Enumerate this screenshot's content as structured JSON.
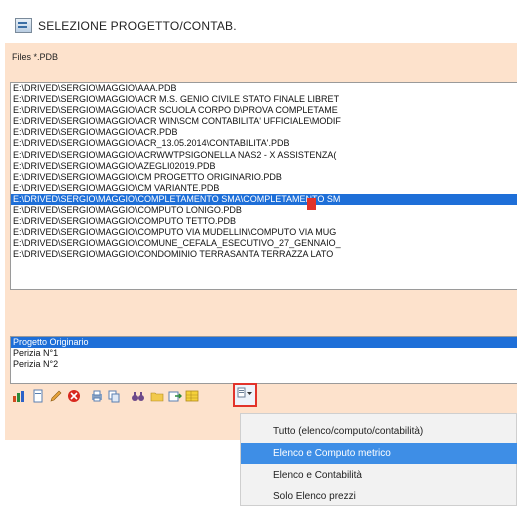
{
  "window": {
    "title": "SELEZIONE PROGETTO/CONTAB."
  },
  "files_label": "Files *.PDB",
  "files": [
    "E:\\DRIVED\\SERGIO\\MAGGIO\\AAA.PDB",
    "E:\\DRIVED\\SERGIO\\MAGGIO\\ACR M.S. GENIO CIVILE  STATO FINALE LIBRET",
    "E:\\DRIVED\\SERGIO\\MAGGIO\\ACR SCUOLA CORPO D\\PROVA COMPLETAME",
    "E:\\DRIVED\\SERGIO\\MAGGIO\\ACR WIN\\SCM CONTABILITA' UFFICIALE\\MODIF",
    "E:\\DRIVED\\SERGIO\\MAGGIO\\ACR.PDB",
    "E:\\DRIVED\\SERGIO\\MAGGIO\\ACR_13.05.2014\\CONTABILITA'.PDB",
    "E:\\DRIVED\\SERGIO\\MAGGIO\\ACRWWTPSIGONELLA NAS2 - X ASSISTENZA(",
    "E:\\DRIVED\\SERGIO\\MAGGIO\\AZEGLI02019.PDB",
    "E:\\DRIVED\\SERGIO\\MAGGIO\\CM PROGETTO ORIGINARIO.PDB",
    "E:\\DRIVED\\SERGIO\\MAGGIO\\CM VARIANTE.PDB",
    "E:\\DRIVED\\SERGIO\\MAGGIO\\COMPLETAMENTO SMA\\COMPLETAMENTO SM",
    "E:\\DRIVED\\SERGIO\\MAGGIO\\COMPUTO LONIGO.PDB",
    "E:\\DRIVED\\SERGIO\\MAGGIO\\COMPUTO TETTO.PDB",
    "E:\\DRIVED\\SERGIO\\MAGGIO\\COMPUTO VIA MUDELLIN\\COMPUTO VIA MUG",
    "E:\\DRIVED\\SERGIO\\MAGGIO\\COMUNE_CEFALA_ESECUTIVO_27_GENNAIO_",
    "E:\\DRIVED\\SERGIO\\MAGGIO\\CONDOMINIO TERRASANTA TERRAZZA LATO"
  ],
  "selected_file_index": 10,
  "variants": [
    "Progetto Originario",
    "Perizia N°1",
    "Perizia N°2"
  ],
  "selected_variant_index": 0,
  "toolbar_icons": [
    "chart-icon",
    "new-doc-icon",
    "edit-icon",
    "delete-icon",
    "print-icon",
    "copy-icon",
    "binoculars-icon",
    "folder-icon",
    "export-icon",
    "table-icon"
  ],
  "dropdown_icon": "options-dropdown-icon",
  "menu": {
    "items": [
      "Tutto (elenco/computo/contabilità)",
      "Elenco e Computo metrico",
      "Elenco e Contabilità",
      "Solo Elenco prezzi"
    ],
    "highlighted_index": 1
  },
  "colors": {
    "frame": "#fde2cc",
    "selection": "#1e6fd8",
    "menu_highlight": "#3e8ee6",
    "marker_red": "#e2332a"
  }
}
